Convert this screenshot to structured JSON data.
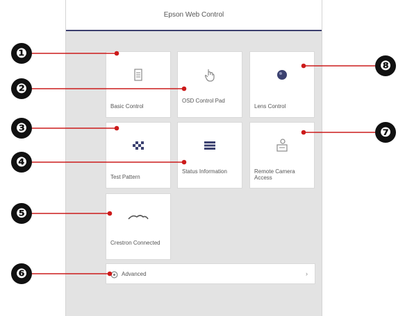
{
  "header": {
    "title": "Epson Web Control"
  },
  "tiles": [
    {
      "label": "Basic Control",
      "icon": "document-icon"
    },
    {
      "label": "OSD Control Pad",
      "icon": "hand-pointer-icon"
    },
    {
      "label": "Lens Control",
      "icon": "lens-icon"
    },
    {
      "label": "Test Pattern",
      "icon": "test-pattern-icon"
    },
    {
      "label": "Status Information",
      "icon": "status-list-icon"
    },
    {
      "label": "Remote Camera Access",
      "icon": "camera-icon"
    },
    {
      "label": "Crestron Connected",
      "icon": "crestron-icon"
    }
  ],
  "advanced": {
    "label": "Advanced",
    "icon": "gear-icon",
    "chevron": "›"
  },
  "callouts": [
    "❶",
    "❷",
    "❸",
    "❹",
    "❺",
    "❻",
    "❼",
    "❽"
  ],
  "colors": {
    "callout": "#111111",
    "leader": "#cc1b1b",
    "header_border": "#3b3f6e"
  }
}
